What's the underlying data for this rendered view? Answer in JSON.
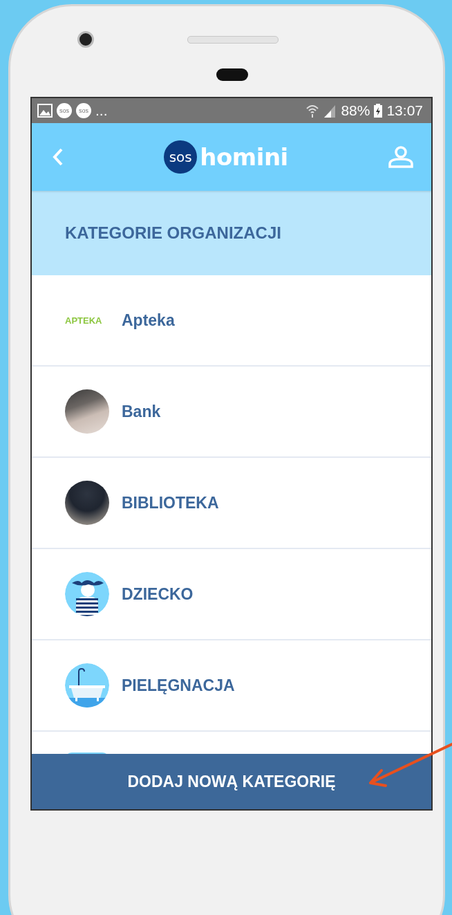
{
  "status_bar": {
    "notification_icons": [
      "sos",
      "sos"
    ],
    "more": "...",
    "battery_percent": "88%",
    "time": "13:07"
  },
  "header": {
    "logo_badge": "sos",
    "logo_text": "homini"
  },
  "section_title": "KATEGORIE ORGANIZACJI",
  "categories": [
    {
      "kind": "text-logo",
      "logo_text": "APTEKA",
      "label": "Apteka"
    },
    {
      "kind": "laptop-photo",
      "label": "Bank"
    },
    {
      "kind": "book-photo",
      "label": "BIBLIOTEKA"
    },
    {
      "kind": "child",
      "label": "DZIECKO"
    },
    {
      "kind": "bathtub",
      "label": "PIELĘGNACJA"
    }
  ],
  "add_button": "DODAJ NOWĄ KATEGORIĘ"
}
